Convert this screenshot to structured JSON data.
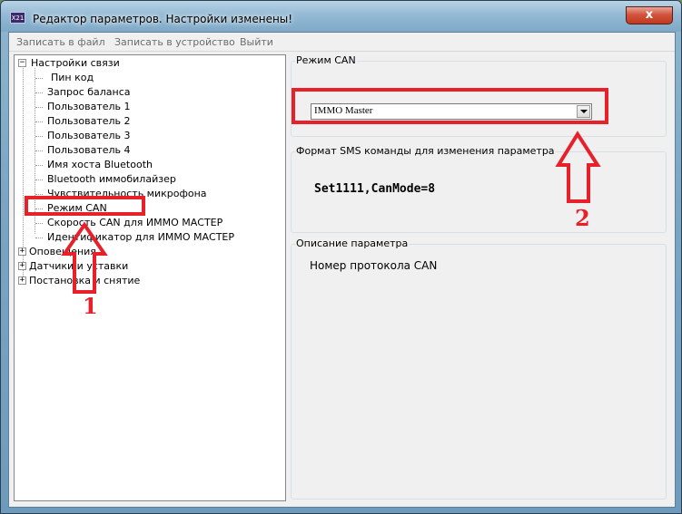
{
  "window": {
    "title": "Редактор параметров. Настройки изменены!",
    "icon_text": "X21",
    "close_glyph": "x"
  },
  "menu": {
    "items": [
      "Записать в файл",
      "Записать в устройство",
      "Выйти"
    ]
  },
  "tree": {
    "groups": [
      {
        "label": "Настройки связи",
        "expanded": true,
        "children": [
          "Пин код",
          "Запрос баланса",
          "Пользователь 1",
          "Пользователь 2",
          "Пользователь 3",
          "Пользователь 4",
          "Имя хоста Bluetooth",
          "Bluetooth иммобилайзер",
          "Чувствительность микрофона",
          "Режим CAN",
          "Скорость CAN для ИММО МАСТЕР",
          "Идентификатор для ИММО МАСТЕР"
        ]
      },
      {
        "label": "Оповещения",
        "expanded": false
      },
      {
        "label": "Датчики и уставки",
        "expanded": false
      },
      {
        "label": "Постановка и снятие",
        "expanded": false
      }
    ],
    "selected": "Режим CAN"
  },
  "param": {
    "group_title": "Режим CAN",
    "combo_value": "IMMO Master"
  },
  "sms": {
    "group_title": "Формат SMS команды для изменения параметра",
    "command": "Set1111,CanMode=8"
  },
  "description": {
    "group_title": "Описание параметра",
    "text": "Номер протокола CAN"
  },
  "annotations": {
    "label_1": "1",
    "label_2": "2",
    "color": "#e8202a"
  },
  "icons": {
    "expanded": "minus-box-icon",
    "collapsed": "plus-box-icon",
    "dropdown": "chevron-down-icon"
  }
}
